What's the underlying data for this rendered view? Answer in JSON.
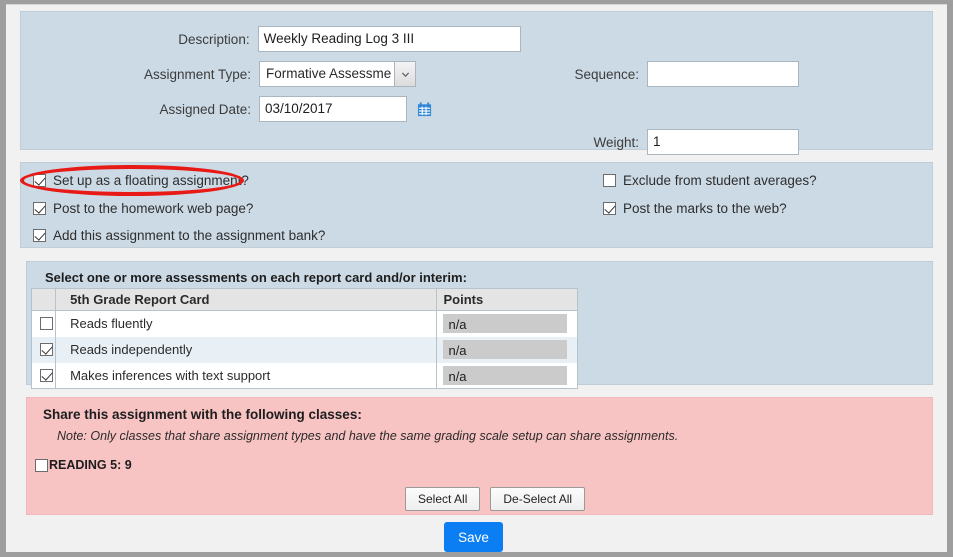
{
  "fields": {
    "description_label": "Description:",
    "description_value": "Weekly Reading Log 3 III",
    "assignment_type_label": "Assignment Type:",
    "assignment_type_value": "Formative Assessme",
    "assigned_date_label": "Assigned Date:",
    "assigned_date_value": "03/10/2017",
    "sequence_label": "Sequence:",
    "sequence_value": "",
    "weight_label": "Weight:",
    "weight_value": "1"
  },
  "options": {
    "left": [
      {
        "label": "Set up as a floating assignment?",
        "checked": true
      },
      {
        "label": "Post to the homework web page?",
        "checked": true
      },
      {
        "label": "Add this assignment to the assignment bank?",
        "checked": true
      }
    ],
    "right": [
      {
        "label": "Exclude from student averages?",
        "checked": false
      },
      {
        "label": "Post the marks to the web?",
        "checked": true
      }
    ]
  },
  "assessments": {
    "heading": "Select one or more assessments on each report card and/or interim:",
    "columns": [
      "5th Grade Report Card",
      "Points"
    ],
    "rows": [
      {
        "checked": false,
        "name": "Reads fluently",
        "points": "n/a"
      },
      {
        "checked": true,
        "name": "Reads independently",
        "points": "n/a"
      },
      {
        "checked": true,
        "name": "Makes inferences with text support",
        "points": "n/a"
      }
    ]
  },
  "share": {
    "title": "Share this assignment with the following classes:",
    "note": "Note: Only classes that share assignment types and have the same grading scale setup can share assignments.",
    "classes": [
      {
        "label": "READING 5: 9",
        "checked": false
      }
    ],
    "select_all_label": "Select All",
    "deselect_all_label": "De-Select All"
  },
  "footer": {
    "save_label": "Save"
  },
  "colors": {
    "panel": "#ccdae5",
    "pink_panel": "#f8c3c3",
    "annotation": "#e81a16",
    "save": "#0b7ef4",
    "calendar_icon": "#2f86d6"
  }
}
